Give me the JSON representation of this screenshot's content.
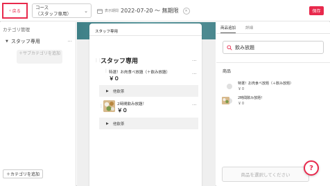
{
  "header": {
    "back_label": "戻る",
    "course_line1": "コース",
    "course_line2": "（スタッフ専用）",
    "period_label": "表示期間",
    "period_value": "2022-07-20 〜 無期限",
    "save_label": "保存"
  },
  "sidebar": {
    "title": "カテゴリ管理",
    "category": "スタッフ専用",
    "sub_add": "＋サブカテゴリを追加",
    "add_category": "＋カテゴリを追加"
  },
  "preview": {
    "tab": "スタッフ専用",
    "category_title": "スタッフ専用",
    "items": [
      {
        "name": "特選！お肉食べ放題（＋飲み放題）",
        "price": "￥０",
        "option": "他飲茶"
      },
      {
        "name": "2時間飲み放題！",
        "price": "￥０",
        "option": "他飲茶"
      }
    ]
  },
  "right": {
    "tab_add": "商品追加",
    "tab_detail": "詳細",
    "search_value": "飲み放題",
    "products_label": "商品",
    "products": [
      {
        "name": "特選！お肉食べ放題（＋飲み放題）",
        "price": "￥０"
      },
      {
        "name": "2時間飲み放題！",
        "price": "￥０"
      }
    ],
    "select_placeholder": "商品を選択してください"
  },
  "colors": {
    "accent": "#e8294c",
    "teal": "#4a878e"
  }
}
